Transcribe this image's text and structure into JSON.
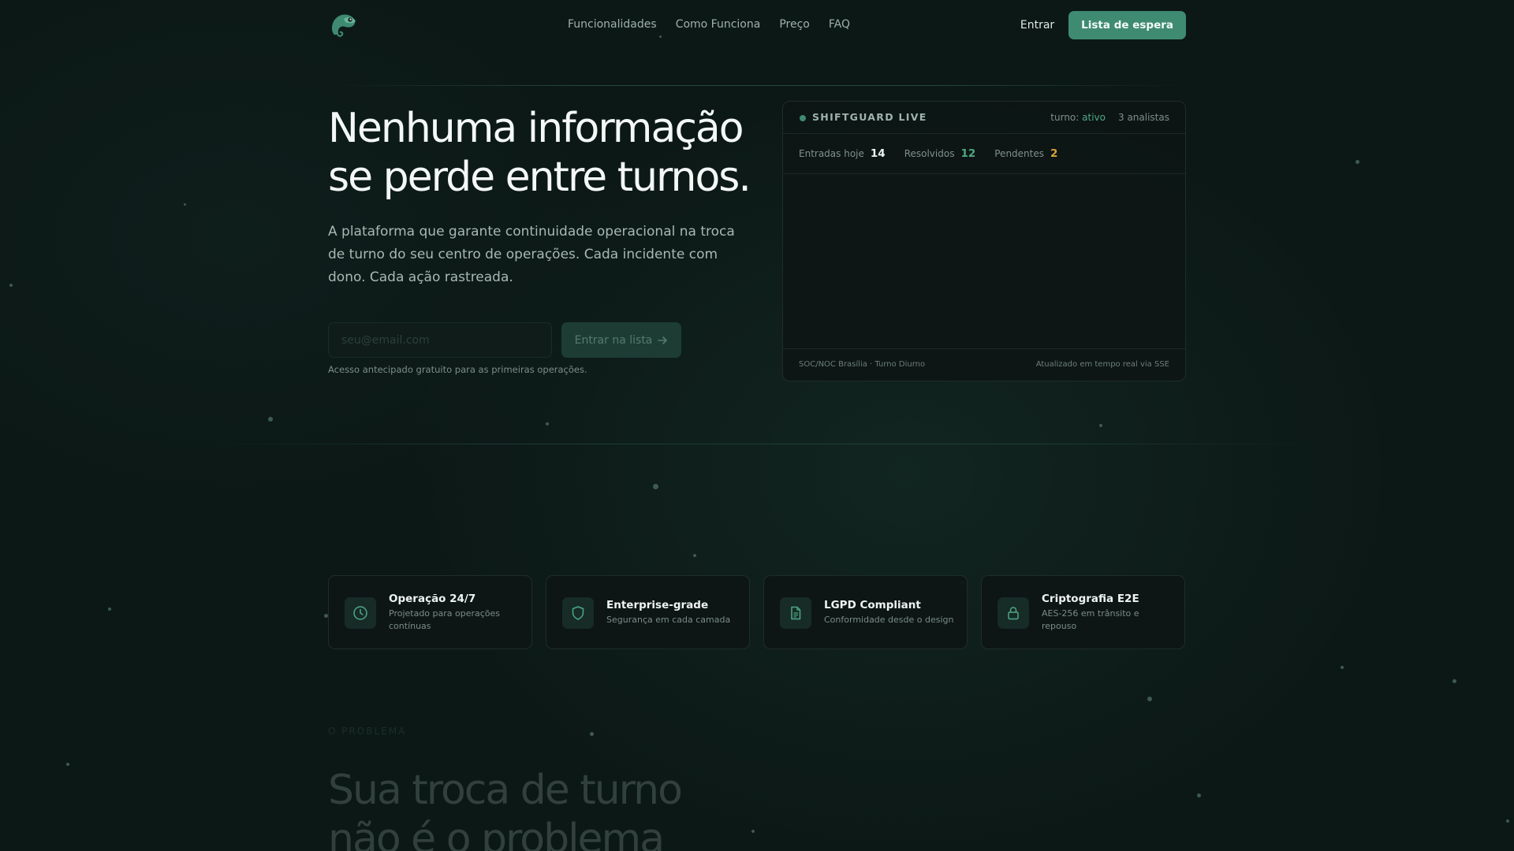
{
  "nav": {
    "links": [
      "Funcionalidades",
      "Como Funciona",
      "Preço",
      "FAQ"
    ],
    "signin": "Entrar",
    "waitlist_button": "Lista de espera"
  },
  "hero": {
    "title_line1": "Nenhuma informação",
    "title_line2": "se perde entre turnos.",
    "subtitle": "A plataforma que garante continuidade operacional na troca de turno do seu centro de operações. Cada incidente com dono. Cada ação rastreada.",
    "email_placeholder": "seu@email.com",
    "join_button": "Entrar na lista",
    "note": "Acesso antecipado gratuito para as primeiras operações."
  },
  "live_panel": {
    "title": "SHIFTGUARD LIVE",
    "shift_label": "turno:",
    "shift_status": "ativo",
    "analysts": "3 analistas",
    "stats": [
      {
        "label": "Entradas hoje",
        "value": "14"
      },
      {
        "label": "Resolvidos",
        "value": "12"
      },
      {
        "label": "Pendentes",
        "value": "2"
      }
    ],
    "footer_left": "SOC/NOC Brasília · Turno Diurno",
    "footer_right": "Atualizado em tempo real via SSE"
  },
  "features": [
    {
      "title": "Operação 24/7",
      "desc": "Projetado para operações contínuas",
      "icon": "clock-icon"
    },
    {
      "title": "Enterprise-grade",
      "desc": "Segurança em cada camada",
      "icon": "shield-icon"
    },
    {
      "title": "LGPD Compliant",
      "desc": "Conformidade desde o design",
      "icon": "document-icon"
    },
    {
      "title": "Criptografia E2E",
      "desc": "AES-256 em trânsito e repouso",
      "icon": "lock-icon"
    }
  ],
  "problem": {
    "label": "O PROBLEMA",
    "title_line1": "Sua troca de turno",
    "title_line2": "não é o problema"
  },
  "colors": {
    "background": "#0c1816",
    "accent": "#3f8b72",
    "accent_text": "#4ea884",
    "warning": "#d9a33b"
  }
}
